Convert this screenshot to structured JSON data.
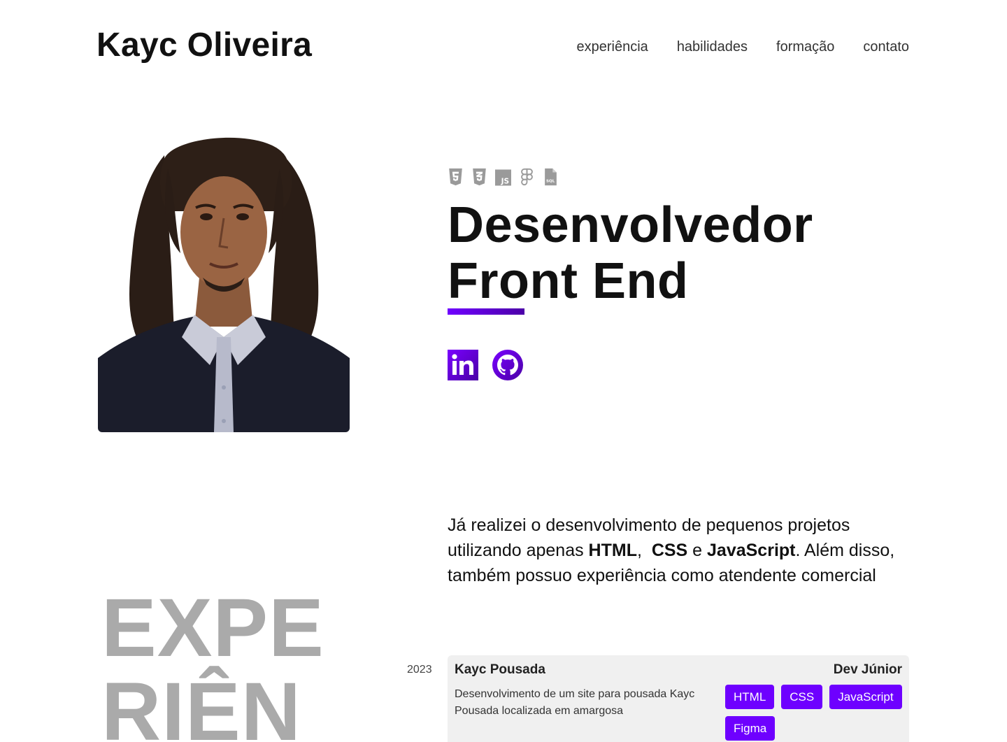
{
  "header": {
    "brand": "Kayc Oliveira",
    "nav": [
      "experiência",
      "habilidades",
      "formação",
      "contato"
    ]
  },
  "hero": {
    "tech_icons": [
      "html5-icon",
      "css3-icon",
      "javascript-icon",
      "figma-icon",
      "sql-file-icon"
    ],
    "title_line1": "Desenvolvedor",
    "title_line2": "Front End",
    "accent_color": "#6e00ff",
    "social": [
      "linkedin-icon",
      "github-icon"
    ]
  },
  "intro": {
    "part1": "Já realizei o desenvolvimento de pequenos projetos utilizando apenas ",
    "html": "HTML",
    "comma": ",  ",
    "css": "CSS",
    "and": " e ",
    "js": "JavaScript",
    "part2": ". Além disso, também possuo experiência como atendente comercial"
  },
  "experience": {
    "heading_line1": "EXPE",
    "heading_line2": "RIÊN",
    "items": [
      {
        "year": "2023",
        "company": "Kayc Pousada",
        "role": "Dev Júnior",
        "description": "Desenvolvimento de um site para pousada Kayc Pousada localizada em amargosa",
        "tags": [
          "HTML",
          "CSS",
          "JavaScript",
          "Figma"
        ]
      }
    ]
  }
}
